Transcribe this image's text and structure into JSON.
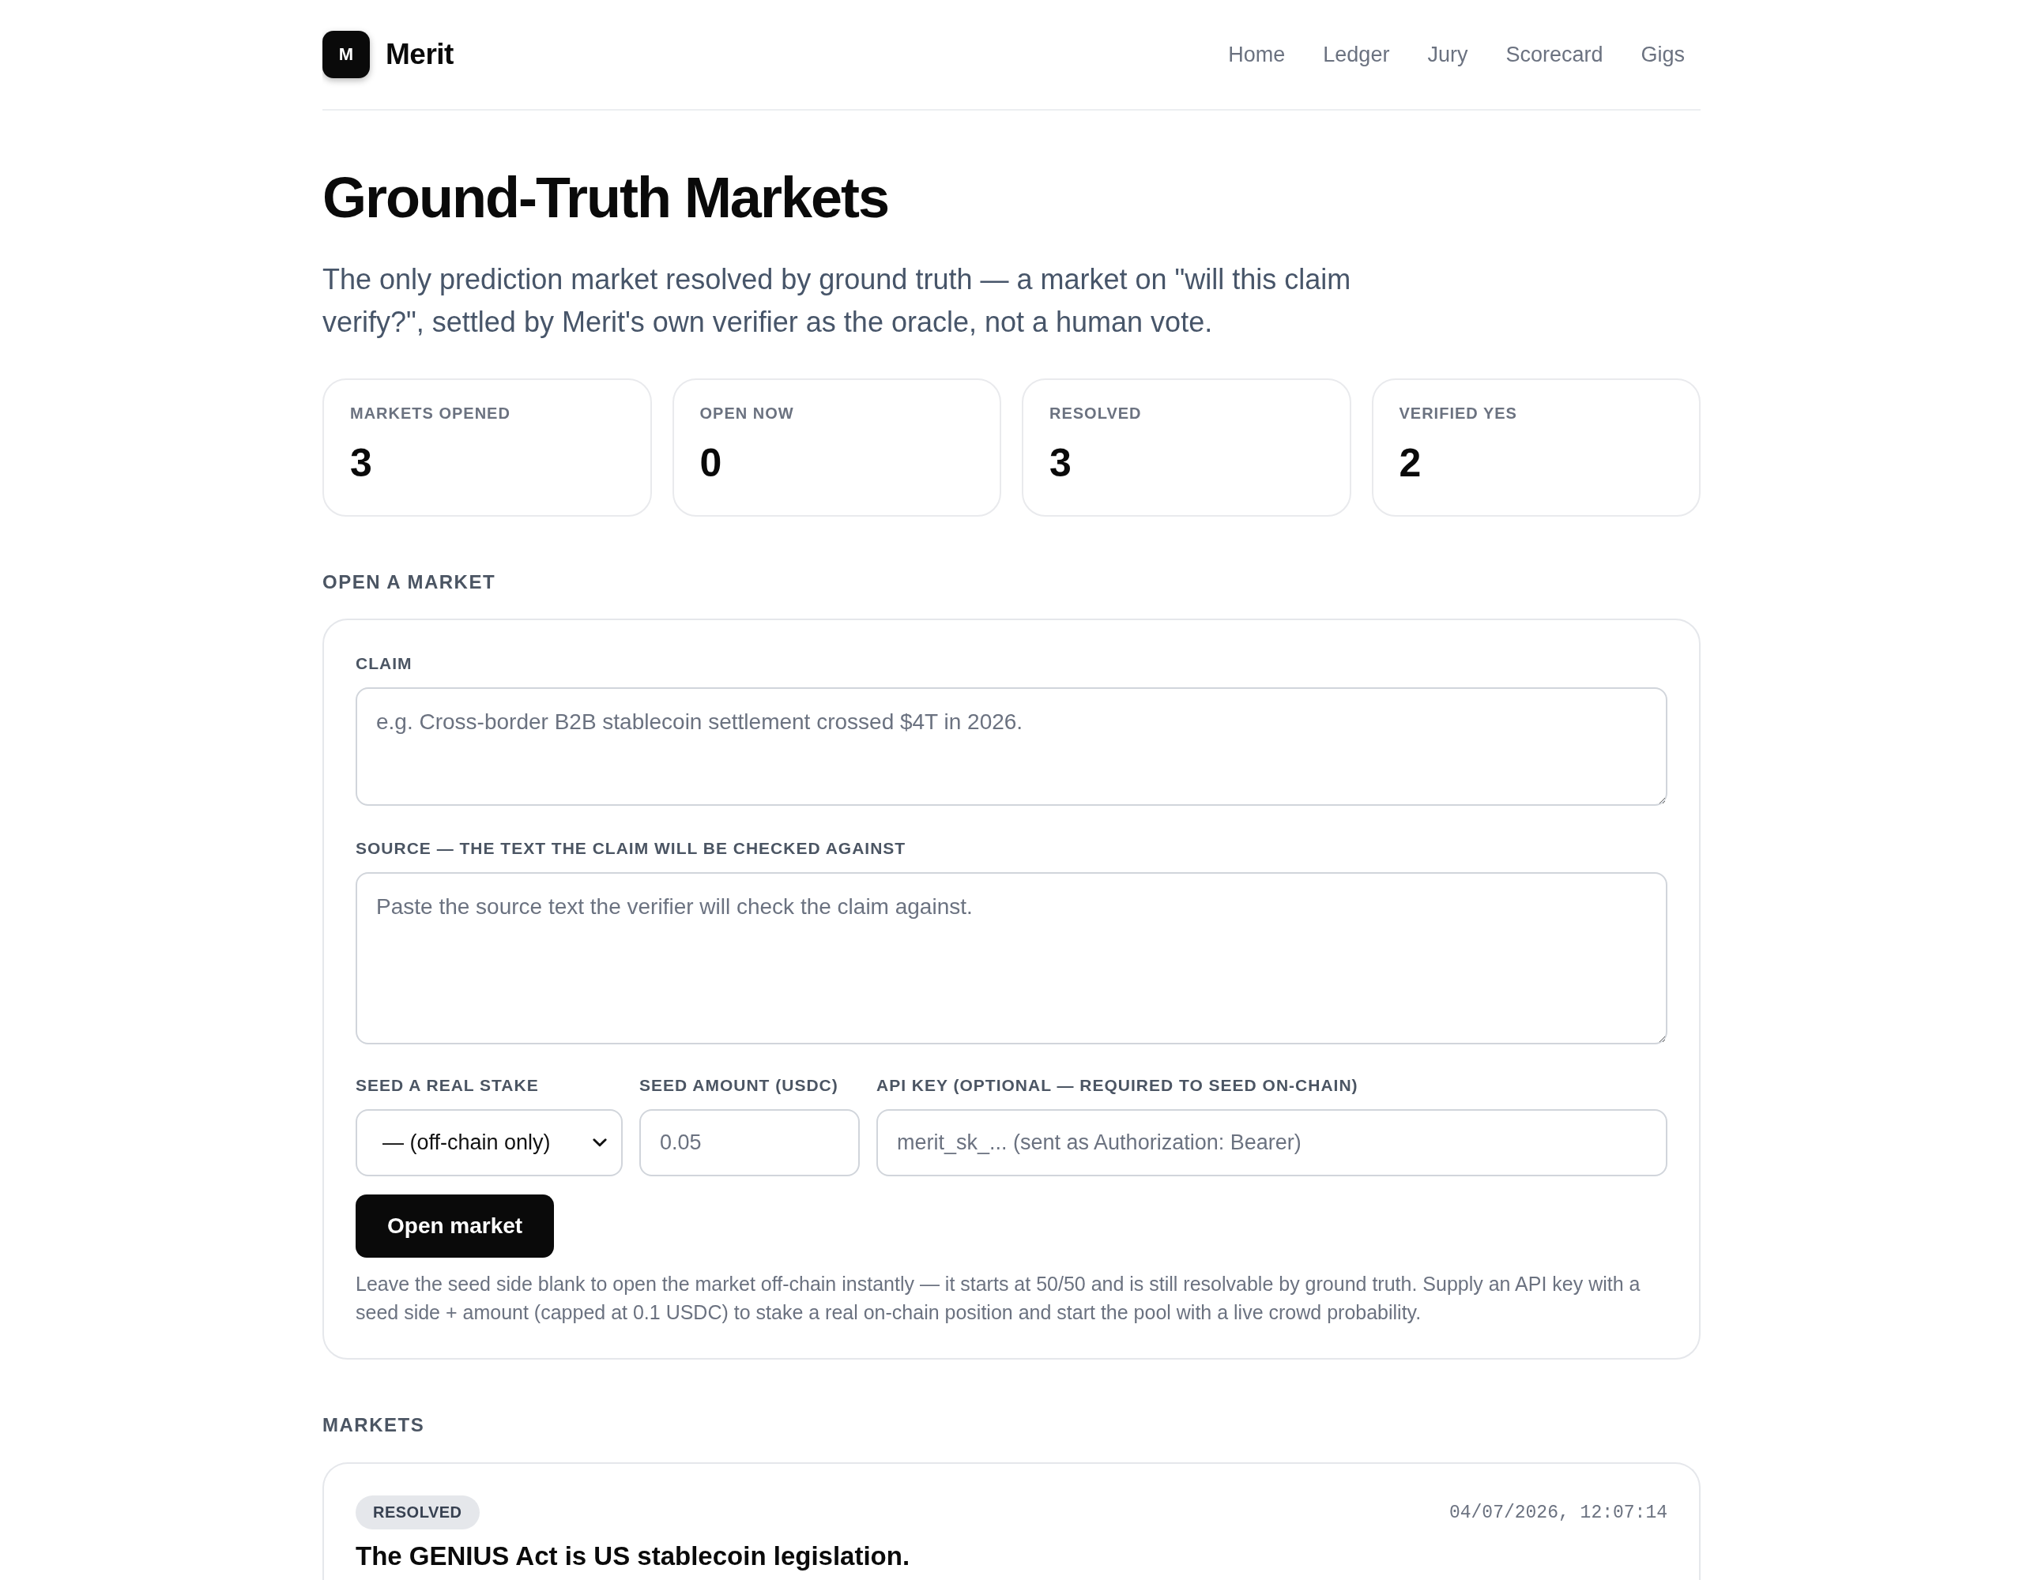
{
  "header": {
    "logo": {
      "letter": "M"
    },
    "brand": "Merit",
    "nav": [
      {
        "label": "Home",
        "selected": false
      },
      {
        "label": "Ledger",
        "selected": false
      },
      {
        "label": "Jury",
        "selected": false
      },
      {
        "label": "Scorecard",
        "selected": false
      },
      {
        "label": "Gigs",
        "selected": false
      }
    ]
  },
  "hero": {
    "title": "Ground-Truth Markets",
    "subtitle": "The only prediction market resolved by ground truth — a market on \"will this claim verify?\", settled by Merit's own verifier as the oracle, not a human vote."
  },
  "stats": [
    {
      "label": "MARKETS OPENED",
      "value": "3"
    },
    {
      "label": "OPEN NOW",
      "value": "0"
    },
    {
      "label": "RESOLVED",
      "value": "3"
    },
    {
      "label": "VERIFIED YES",
      "value": "2"
    }
  ],
  "open_market": {
    "heading": "OPEN A MARKET",
    "text_areas": [
      {
        "label": "CLAIM",
        "placeholder": "e.g. Cross-border B2B stablecoin settlement crossed $4T in 2026."
      },
      {
        "label": "SOURCE — THE TEXT THE CLAIM WILL BE CHECKED AGAINST",
        "placeholder": "Paste the source text the verifier will check the claim against."
      }
    ],
    "inputs": [
      {
        "kind": "select",
        "label": "SEED A REAL STAKE",
        "value": "— (off-chain only)"
      },
      {
        "kind": "input",
        "label": "SEED AMOUNT (USDC)",
        "placeholder": "0.05"
      },
      {
        "kind": "input",
        "label": "API KEY (OPTIONAL — REQUIRED TO SEED ON-CHAIN)",
        "placeholder": "merit_sk_... (sent as Authorization: Bearer)"
      }
    ],
    "button": "Open market",
    "note": "Leave the seed side blank to open the market off-chain instantly — it starts at 50/50 and is still resolvable by ground truth. Supply an API key with a seed side + amount (capped at 0.1 USDC) to stake a real on-chain position and start the pool with a live crowd probability."
  },
  "markets": {
    "heading": "MARKETS",
    "items": [
      {
        "status": "RESOLVED",
        "timestamp": "04/07/2026, 12:07:14",
        "claim": "The GENIUS Act is US stablecoin legislation."
      }
    ]
  }
}
